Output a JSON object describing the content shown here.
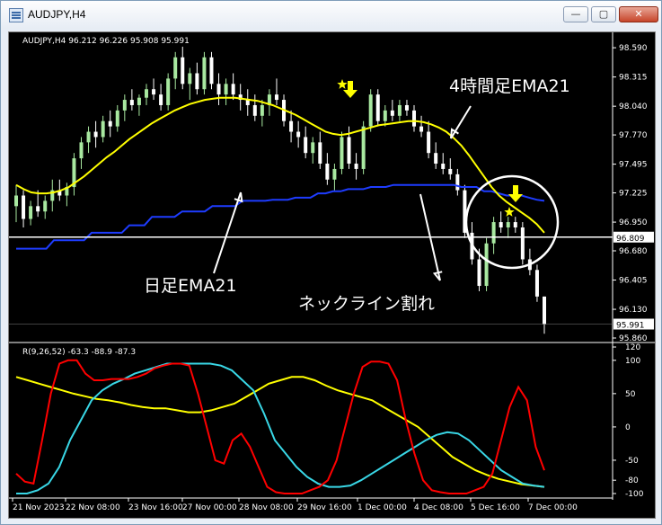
{
  "window": {
    "title": "AUDJPY,H4",
    "minimize_glyph": "—",
    "maximize_glyph": "▢",
    "close_glyph": "✕"
  },
  "colors": {
    "background": "#000000",
    "bull_candle": "#a8e8a0",
    "bear_candle": "#ffffff",
    "ema4h": "#ffff00",
    "ema_daily": "#1e3cff",
    "annotation": "#ffffff",
    "arrow": "#ffff00",
    "osc_red": "#ff0000",
    "osc_cyan": "#39d7e6",
    "osc_yellow": "#ffff00"
  },
  "chart_data": [
    {
      "type": "candlestick",
      "title": "AUDJPY,H4  96.212 96.226 95.908 95.991",
      "symbol_label": "AUDJPY,H4",
      "ohlc_label": "96.212 96.226 95.908 95.991",
      "ylim": [
        95.86,
        98.65
      ],
      "y_ticks": [
        "98.590",
        "98.315",
        "98.040",
        "97.770",
        "97.495",
        "97.225",
        "96.950",
        "96.680",
        "96.405",
        "96.130",
        "95.860"
      ],
      "horizontal_line": {
        "value": 96.809,
        "label": "96.809"
      },
      "last_price": {
        "value": 95.991,
        "label": "95.991"
      },
      "x_ticks": [
        "21 Nov 2023",
        "22 Nov 08:00",
        "23 Nov 16:00",
        "27 Nov 00:00",
        "28 Nov 08:00",
        "29 Nov 16:00",
        "1 Dec 00:00",
        "4 Dec 08:00",
        "5 Dec 16:00",
        "7 Dec 00:00"
      ],
      "candles": [
        [
          97.1,
          97.3,
          96.95,
          97.2
        ],
        [
          97.2,
          97.25,
          96.9,
          96.98
        ],
        [
          96.98,
          97.15,
          96.92,
          97.1
        ],
        [
          97.1,
          97.25,
          97.0,
          97.05
        ],
        [
          97.05,
          97.2,
          96.98,
          97.15
        ],
        [
          97.15,
          97.35,
          97.05,
          97.25
        ],
        [
          97.25,
          97.35,
          97.15,
          97.2
        ],
        [
          97.2,
          97.32,
          97.1,
          97.28
        ],
        [
          97.28,
          97.6,
          97.2,
          97.55
        ],
        [
          97.55,
          97.75,
          97.45,
          97.7
        ],
        [
          97.7,
          97.85,
          97.6,
          97.8
        ],
        [
          97.8,
          97.9,
          97.65,
          97.75
        ],
        [
          97.75,
          97.95,
          97.7,
          97.9
        ],
        [
          97.9,
          98.0,
          97.75,
          97.85
        ],
        [
          97.85,
          98.05,
          97.8,
          98.0
        ],
        [
          98.0,
          98.15,
          97.9,
          98.1
        ],
        [
          98.1,
          98.2,
          98.0,
          98.05
        ],
        [
          98.05,
          98.15,
          97.95,
          98.12
        ],
        [
          98.12,
          98.25,
          98.05,
          98.2
        ],
        [
          98.2,
          98.3,
          98.1,
          98.15
        ],
        [
          98.15,
          98.25,
          98.0,
          98.05
        ],
        [
          98.05,
          98.35,
          98.0,
          98.3
        ],
        [
          98.3,
          98.55,
          98.2,
          98.5
        ],
        [
          98.5,
          98.6,
          98.2,
          98.25
        ],
        [
          98.25,
          98.4,
          98.1,
          98.35
        ],
        [
          98.35,
          98.45,
          98.15,
          98.2
        ],
        [
          98.2,
          98.55,
          98.15,
          98.5
        ],
        [
          98.5,
          98.55,
          98.2,
          98.25
        ],
        [
          98.25,
          98.35,
          98.05,
          98.15
        ],
        [
          98.15,
          98.3,
          98.05,
          98.25
        ],
        [
          98.25,
          98.35,
          98.1,
          98.15
        ],
        [
          98.15,
          98.25,
          98.0,
          98.1
        ],
        [
          98.1,
          98.2,
          97.95,
          98.05
        ],
        [
          98.05,
          98.15,
          97.9,
          97.95
        ],
        [
          97.95,
          98.1,
          97.85,
          98.05
        ],
        [
          98.05,
          98.2,
          97.95,
          98.15
        ],
        [
          98.15,
          98.3,
          98.05,
          98.1
        ],
        [
          98.1,
          98.15,
          97.85,
          97.9
        ],
        [
          97.9,
          98.0,
          97.7,
          97.8
        ],
        [
          97.8,
          97.9,
          97.65,
          97.75
        ],
        [
          97.75,
          97.85,
          97.55,
          97.6
        ],
        [
          97.6,
          97.75,
          97.5,
          97.7
        ],
        [
          97.7,
          97.8,
          97.45,
          97.5
        ],
        [
          97.5,
          97.6,
          97.3,
          97.35
        ],
        [
          97.35,
          97.5,
          97.25,
          97.45
        ],
        [
          97.45,
          97.8,
          97.4,
          97.75
        ],
        [
          97.75,
          97.85,
          97.45,
          97.5
        ],
        [
          97.5,
          97.6,
          97.35,
          97.45
        ],
        [
          97.45,
          97.9,
          97.4,
          97.85
        ],
        [
          97.85,
          98.2,
          97.8,
          98.15
        ],
        [
          98.15,
          98.2,
          97.85,
          97.9
        ],
        [
          97.9,
          98.05,
          97.85,
          98.0
        ],
        [
          98.0,
          98.1,
          97.9,
          97.95
        ],
        [
          97.95,
          98.1,
          97.9,
          98.05
        ],
        [
          98.05,
          98.1,
          97.95,
          98.0
        ],
        [
          98.0,
          98.05,
          97.8,
          97.85
        ],
        [
          97.85,
          97.95,
          97.75,
          97.8
        ],
        [
          97.8,
          97.9,
          97.55,
          97.6
        ],
        [
          97.6,
          97.7,
          97.45,
          97.5
        ],
        [
          97.5,
          97.6,
          97.4,
          97.45
        ],
        [
          97.45,
          97.55,
          97.35,
          97.4
        ],
        [
          97.4,
          97.45,
          97.2,
          97.25
        ],
        [
          97.25,
          97.3,
          96.8,
          96.85
        ],
        [
          96.85,
          96.95,
          96.55,
          96.6
        ],
        [
          96.6,
          96.7,
          96.3,
          96.35
        ],
        [
          96.35,
          96.8,
          96.3,
          96.75
        ],
        [
          96.75,
          97.0,
          96.65,
          96.95
        ],
        [
          96.95,
          97.05,
          96.85,
          96.9
        ],
        [
          96.9,
          97.0,
          96.8,
          96.95
        ],
        [
          96.95,
          97.0,
          96.85,
          96.9
        ],
        [
          96.9,
          96.95,
          96.55,
          96.6
        ],
        [
          96.6,
          96.7,
          96.45,
          96.5
        ],
        [
          96.5,
          96.55,
          96.2,
          96.25
        ],
        [
          96.25,
          96.25,
          95.9,
          95.99
        ]
      ],
      "series": [
        {
          "name": "EMA21 (H4)",
          "color": "#ffff00",
          "values": [
            97.3,
            97.26,
            97.23,
            97.22,
            97.22,
            97.23,
            97.25,
            97.28,
            97.33,
            97.38,
            97.44,
            97.5,
            97.56,
            97.61,
            97.67,
            97.73,
            97.78,
            97.83,
            97.88,
            97.92,
            97.96,
            98.0,
            98.03,
            98.06,
            98.08,
            98.1,
            98.11,
            98.12,
            98.12,
            98.12,
            98.11,
            98.1,
            98.09,
            98.07,
            98.05,
            98.02,
            97.99,
            97.96,
            97.92,
            97.88,
            97.84,
            97.8,
            97.78,
            97.77,
            97.78,
            97.8,
            97.82,
            97.84,
            97.86,
            97.87,
            97.88,
            97.89,
            97.9,
            97.9,
            97.89,
            97.87,
            97.84,
            97.8,
            97.74,
            97.67,
            97.58,
            97.48,
            97.38,
            97.28,
            97.2,
            97.14,
            97.09,
            97.04,
            96.99,
            96.93,
            96.85
          ]
        },
        {
          "name": "EMA21 (Daily)",
          "color": "#1e3cff",
          "values": [
            96.7,
            96.7,
            96.7,
            96.7,
            96.7,
            96.78,
            96.78,
            96.78,
            96.78,
            96.78,
            96.85,
            96.85,
            96.85,
            96.85,
            96.85,
            96.92,
            96.92,
            96.92,
            97.0,
            97.0,
            97.0,
            97.0,
            97.05,
            97.05,
            97.05,
            97.05,
            97.1,
            97.1,
            97.1,
            97.1,
            97.15,
            97.15,
            97.15,
            97.15,
            97.16,
            97.16,
            97.16,
            97.18,
            97.18,
            97.18,
            97.22,
            97.22,
            97.24,
            97.24,
            97.26,
            97.26,
            97.26,
            97.28,
            97.28,
            97.28,
            97.3,
            97.3,
            97.3,
            97.3,
            97.3,
            97.3,
            97.3,
            97.3,
            97.3,
            97.28,
            97.28,
            97.28,
            97.24,
            97.24,
            97.22,
            97.2,
            97.2,
            97.2,
            97.18,
            97.16,
            97.15
          ]
        }
      ],
      "annotations": [
        "4時間足EMA21",
        "日足EMA21",
        "ネックライン割れ"
      ]
    },
    {
      "type": "line",
      "title": "R(9,26,52) -63.3 -88.9 -87.3",
      "ylim": [
        -100,
        120
      ],
      "y_ticks": [
        "120",
        "100",
        "50",
        "0",
        "-50",
        "-80",
        "-100"
      ],
      "series": [
        {
          "name": "",
          "color": "#ff0000",
          "values": [
            -70,
            -82,
            -85,
            -20,
            50,
            95,
            100,
            100,
            80,
            70,
            70,
            72,
            72,
            72,
            75,
            80,
            88,
            92,
            95,
            95,
            92,
            50,
            0,
            -50,
            -55,
            -20,
            -10,
            -30,
            -60,
            -90,
            -98,
            -100,
            -100,
            -100,
            -95,
            -90,
            -80,
            -50,
            0,
            50,
            90,
            98,
            98,
            95,
            70,
            10,
            -40,
            -80,
            -95,
            -98,
            -100,
            -100,
            -100,
            -95,
            -90,
            -70,
            -20,
            30,
            60,
            40,
            -30,
            -65
          ]
        },
        {
          "name": "",
          "color": "#39d7e6",
          "values": [
            -100,
            -100,
            -95,
            -85,
            -60,
            -20,
            10,
            40,
            55,
            65,
            72,
            80,
            85,
            90,
            95,
            95,
            95,
            95,
            95,
            92,
            85,
            70,
            55,
            20,
            -20,
            -40,
            -60,
            -75,
            -85,
            -90,
            -90,
            -88,
            -80,
            -70,
            -60,
            -50,
            -40,
            -30,
            -20,
            -12,
            -8,
            -10,
            -20,
            -35,
            -50,
            -65,
            -75,
            -85,
            -88,
            -90
          ]
        },
        {
          "name": "",
          "color": "#ffff00",
          "values": [
            75,
            70,
            65,
            60,
            55,
            50,
            46,
            42,
            40,
            37,
            33,
            30,
            28,
            28,
            25,
            22,
            22,
            25,
            30,
            35,
            45,
            55,
            65,
            70,
            75,
            75,
            70,
            62,
            55,
            50,
            45,
            40,
            30,
            20,
            10,
            0,
            -15,
            -30,
            -45,
            -55,
            -65,
            -72,
            -78,
            -82,
            -86,
            -88,
            -90
          ]
        }
      ]
    }
  ]
}
